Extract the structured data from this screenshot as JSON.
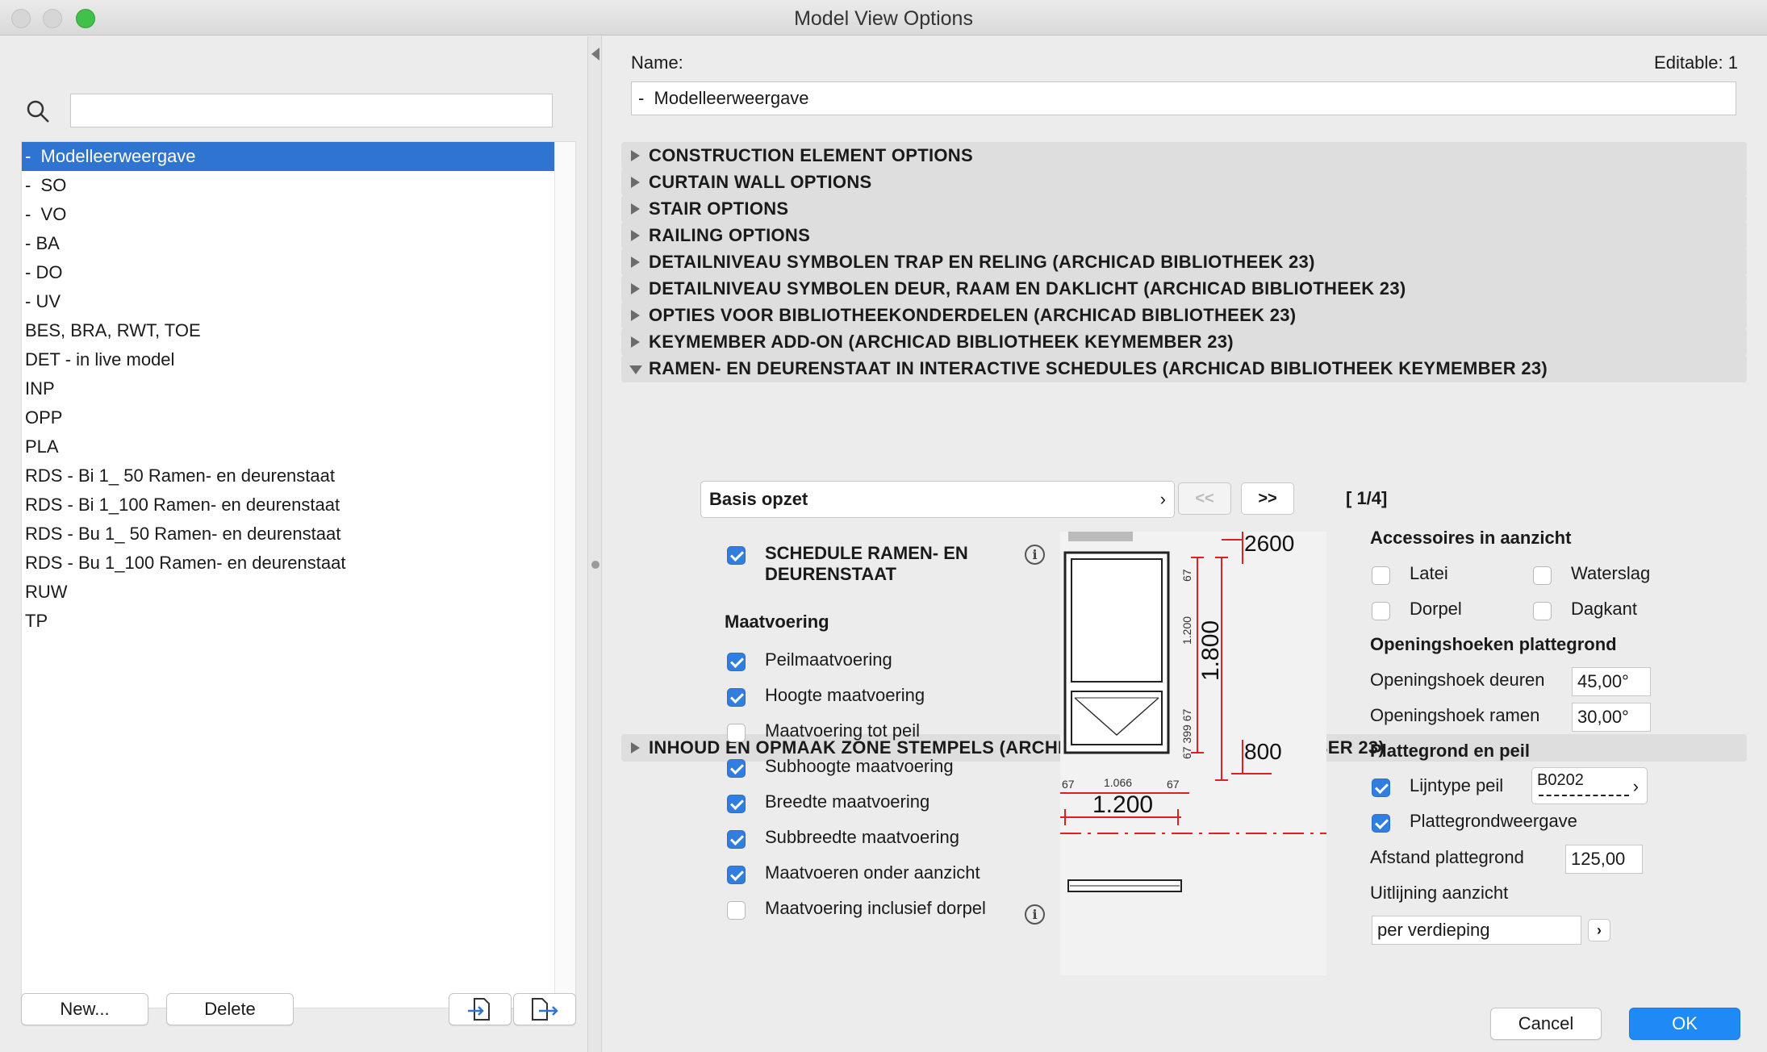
{
  "window": {
    "title": "Model View Options"
  },
  "left": {
    "search": {
      "placeholder": ""
    },
    "items": [
      {
        "label": "-  Modelleerweergave",
        "selected": true
      },
      {
        "label": "-  SO"
      },
      {
        "label": "-  VO"
      },
      {
        "label": "- BA"
      },
      {
        "label": "- DO"
      },
      {
        "label": "- UV"
      },
      {
        "label": "BES, BRA, RWT, TOE"
      },
      {
        "label": "DET - in live model"
      },
      {
        "label": "INP"
      },
      {
        "label": "OPP"
      },
      {
        "label": "PLA"
      },
      {
        "label": "RDS - Bi 1_ 50 Ramen- en deurenstaat"
      },
      {
        "label": "RDS - Bi 1_100 Ramen- en deurenstaat"
      },
      {
        "label": "RDS - Bu 1_ 50 Ramen- en deurenstaat"
      },
      {
        "label": "RDS - Bu 1_100 Ramen- en deurenstaat"
      },
      {
        "label": "RUW"
      },
      {
        "label": "TP"
      }
    ],
    "buttons": {
      "new": "New...",
      "delete": "Delete"
    }
  },
  "right": {
    "name_label": "Name:",
    "editable_label": "Editable: 1",
    "name_value": "-  Modelleerweergave",
    "sections": [
      {
        "label": "CONSTRUCTION ELEMENT OPTIONS",
        "expanded": false
      },
      {
        "label": "CURTAIN WALL OPTIONS",
        "expanded": false
      },
      {
        "label": "STAIR OPTIONS",
        "expanded": false
      },
      {
        "label": "RAILING OPTIONS",
        "expanded": false
      },
      {
        "label": "DETAILNIVEAU SYMBOLEN TRAP EN RELING (ARCHICAD BIBLIOTHEEK 23)",
        "expanded": false
      },
      {
        "label": "DETAILNIVEAU SYMBOLEN DEUR, RAAM EN DAKLICHT (ARCHICAD BIBLIOTHEEK 23)",
        "expanded": false
      },
      {
        "label": "OPTIES VOOR BIBLIOTHEEKONDERDELEN (ARCHICAD BIBLIOTHEEK 23)",
        "expanded": false
      },
      {
        "label": "KEYMEMBER ADD-ON (ARCHICAD BIBLIOTHEEK KEYMEMBER 23)",
        "expanded": false
      },
      {
        "label": "RAMEN- EN DEURENSTAAT IN INTERACTIVE SCHEDULES (ARCHICAD BIBLIOTHEEK KEYMEMBER 23)",
        "expanded": true
      },
      {
        "label": "INHOUD EN OPMAAK ZONE STEMPELS (ARCHICAD BIBLIOTHEEK KEYMEMBER 23)",
        "expanded": false
      }
    ],
    "expanded": {
      "page_dropdown": "Basis opzet",
      "prev_label": "<<",
      "next_label": ">>",
      "page_indicator": "[ 1/4]",
      "schedule_label": "SCHEDULE RAMEN- EN DEURENSTAAT",
      "schedule_checked": true,
      "maatvoering_heading": "Maatvoering",
      "maatvoering": [
        {
          "label": "Peilmaatvoering",
          "checked": true
        },
        {
          "label": "Hoogte maatvoering",
          "checked": true
        },
        {
          "label": "Maatvoering tot peil",
          "checked": false
        },
        {
          "label": "Subhoogte maatvoering",
          "checked": true
        },
        {
          "label": "Breedte maatvoering",
          "checked": true
        },
        {
          "label": "Subbreedte maatvoering",
          "checked": true
        },
        {
          "label": "Maatvoeren onder aanzicht",
          "checked": true
        },
        {
          "label": "Maatvoering inclusief dorpel",
          "checked": false
        }
      ],
      "figure": {
        "dim_top": "2600",
        "dim_height": "1.800",
        "dim_sub": "1.200",
        "dim_small": "67 399 67",
        "dim_top_small": "67",
        "dim_bottom": "800",
        "dim_width": "1.200",
        "dim_width_sub": "1.066",
        "dim_w_left": "67",
        "dim_w_right": "67"
      },
      "accessoires_heading": "Accessoires in aanzicht",
      "accessoires": [
        {
          "label": "Latei",
          "checked": false
        },
        {
          "label": "Waterslag",
          "checked": false
        },
        {
          "label": "Dorpel",
          "checked": false
        },
        {
          "label": "Dagkant",
          "checked": false
        }
      ],
      "openingshoeken_heading": "Openingshoeken plattegrond",
      "openingshoek_deuren_label": "Openingshoek deuren",
      "openingshoek_deuren_value": "45,00°",
      "openingshoek_ramen_label": "Openingshoek ramen",
      "openingshoek_ramen_value": "30,00°",
      "plattegrond_heading": "Plattegrond en peil",
      "lijntype_label": "Lijntype peil",
      "lijntype_checked": true,
      "lijntype_value": "B0202",
      "plattegrondweergave_label": "Plattegrondweergave",
      "plattegrondweergave_checked": true,
      "afstand_label": "Afstand plattegrond",
      "afstand_value": "125,00",
      "uitlijning_label": "Uitlijning aanzicht",
      "uitlijning_value": "per verdieping"
    },
    "buttons": {
      "cancel": "Cancel",
      "ok": "OK"
    }
  },
  "colors": {
    "accent": "#2f74d0",
    "ok_button": "#1f8af5",
    "dimension_red": "#e02020"
  },
  "icons": [
    "search-icon",
    "disclosure-triangle-icon",
    "info-icon",
    "chevron-right-icon",
    "import-icon",
    "export-icon"
  ]
}
